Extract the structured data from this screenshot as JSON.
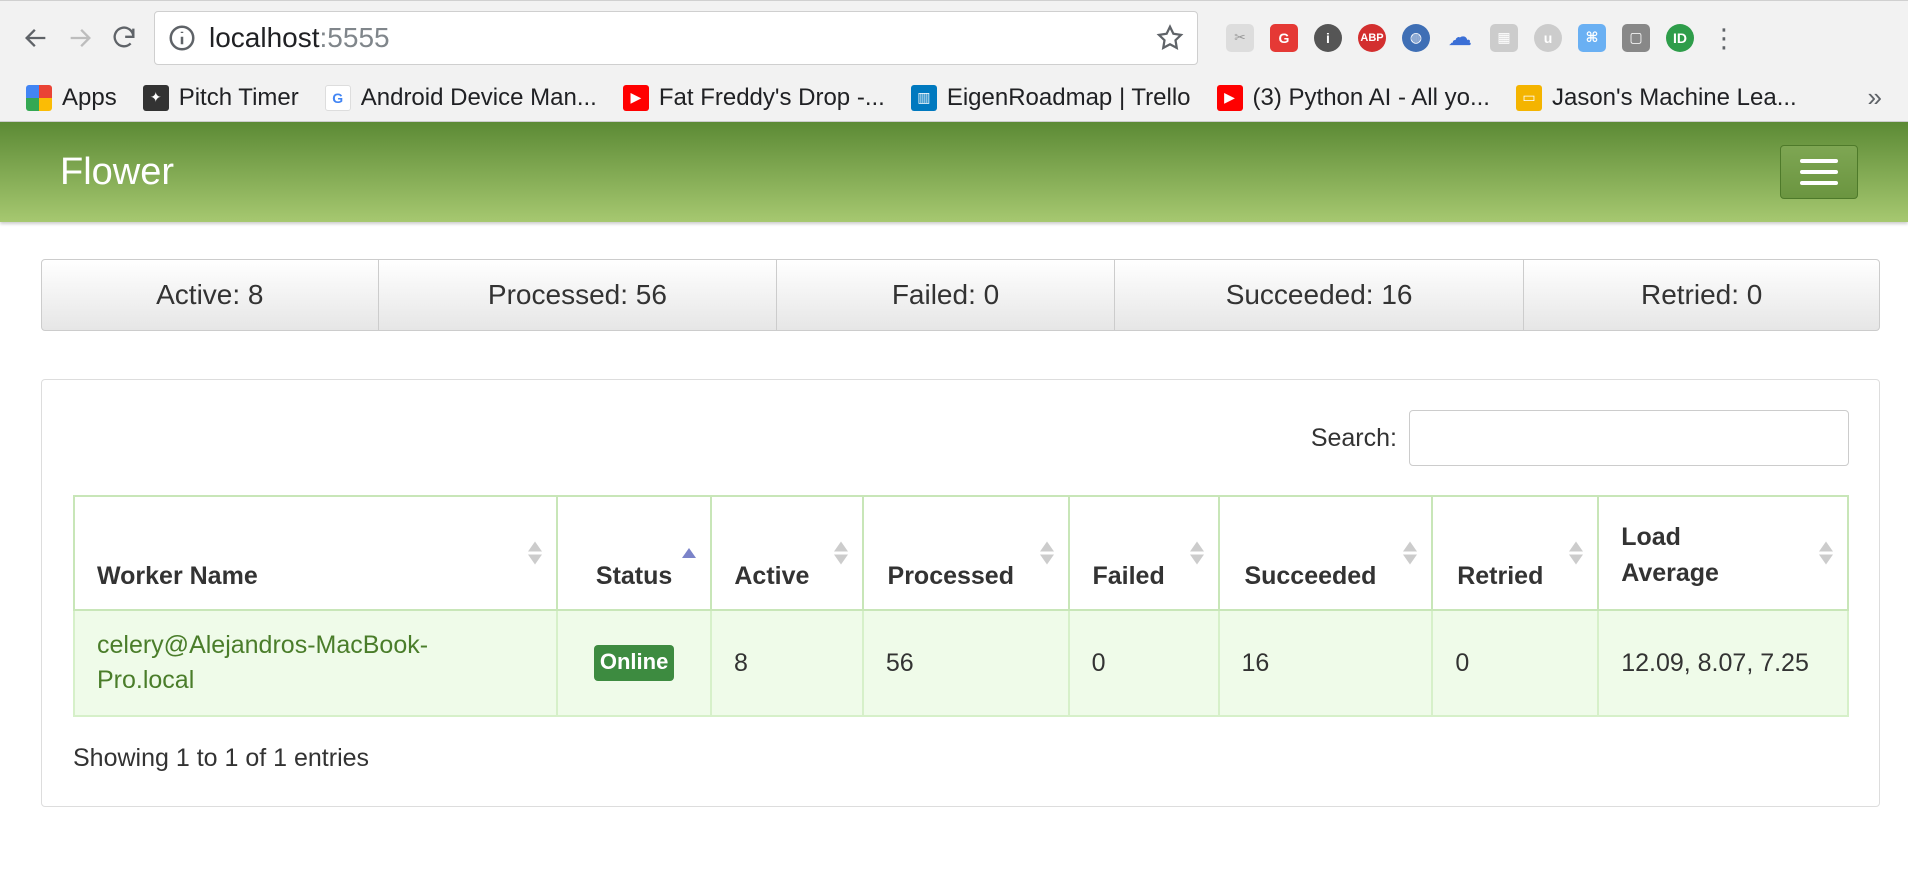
{
  "browser": {
    "url_host": "localhost",
    "url_port": ":5555",
    "bookmarks": [
      {
        "label": "Apps",
        "icon": "apps-grid-icon",
        "color": "#4285f4"
      },
      {
        "label": "Pitch Timer",
        "icon": "pitch-timer-icon",
        "color": "#333333"
      },
      {
        "label": "Android Device Man...",
        "icon": "google-icon",
        "color": "#ea4335"
      },
      {
        "label": "Fat Freddy's Drop -...",
        "icon": "youtube-icon",
        "color": "#ff0000"
      },
      {
        "label": "EigenRoadmap | Trello",
        "icon": "trello-icon",
        "color": "#0079bf"
      },
      {
        "label": "(3) Python AI - All yo...",
        "icon": "youtube-icon",
        "color": "#ff0000"
      },
      {
        "label": "Jason's Machine Lea...",
        "icon": "slides-icon",
        "color": "#f4b400"
      }
    ],
    "more_bookmarks": "»"
  },
  "app": {
    "brand": "Flower"
  },
  "stats": [
    {
      "label": "Active: 8"
    },
    {
      "label": "Processed: 56"
    },
    {
      "label": "Failed: 0"
    },
    {
      "label": "Succeeded: 16"
    },
    {
      "label": "Retried: 0"
    }
  ],
  "search": {
    "label": "Search:",
    "value": ""
  },
  "table": {
    "headers": {
      "worker_name": "Worker Name",
      "status": "Status",
      "active": "Active",
      "processed": "Processed",
      "failed": "Failed",
      "succeeded": "Succeeded",
      "retried": "Retried",
      "load_average": "Load Average"
    },
    "rows": [
      {
        "worker_name": "celery@Alejandros-MacBook-Pro.local",
        "status": "Online",
        "active": "8",
        "processed": "56",
        "failed": "0",
        "succeeded": "16",
        "retried": "0",
        "load_average": "12.09, 8.07, 7.25"
      }
    ],
    "footer": "Showing 1 to 1 of 1 entries"
  }
}
